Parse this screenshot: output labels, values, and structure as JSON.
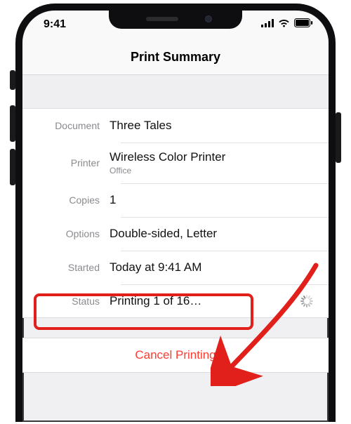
{
  "statusbar": {
    "time": "9:41"
  },
  "header": {
    "title": "Print Summary"
  },
  "rows": {
    "document": {
      "label": "Document",
      "value": "Three Tales"
    },
    "printer": {
      "label": "Printer",
      "value": "Wireless Color Printer",
      "sub": "Office"
    },
    "copies": {
      "label": "Copies",
      "value": "1"
    },
    "options": {
      "label": "Options",
      "value": "Double-sided, Letter"
    },
    "started": {
      "label": "Started",
      "value": "Today at 9:41 AM"
    },
    "status": {
      "label": "Status",
      "value": "Printing 1 of 16…"
    }
  },
  "actions": {
    "cancel": "Cancel Printing"
  },
  "colors": {
    "destructive": "#ff3b30",
    "highlight": "#e2201b"
  }
}
